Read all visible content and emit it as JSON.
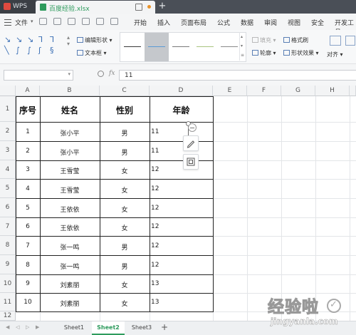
{
  "titlebar": {
    "app_label": "WPS",
    "doc_name": "百度经验.xlsx",
    "new_tab": "+"
  },
  "menubar": {
    "file_label": "文件",
    "items": [
      "开始",
      "插入",
      "页面布局",
      "公式",
      "数据",
      "审阅",
      "视图",
      "安全",
      "开发工具"
    ]
  },
  "ribbon": {
    "edit_shape": "编辑形状",
    "text_box": "文本框",
    "fill": "填充",
    "format_painter": "格式刷",
    "outline": "轮廓",
    "shape_effects": "形状效果",
    "align": "对齐",
    "style_colors": [
      "#3a3a3a",
      "#5b9bd5",
      "#7a7a7a",
      "#a9c47f",
      "#8a8a8a"
    ]
  },
  "formula_bar": {
    "name_box": "",
    "fx": "fx",
    "zoom_icon": "magnifier-icon",
    "value": "11"
  },
  "columns": [
    "A",
    "B",
    "C",
    "D",
    "E",
    "F",
    "G",
    "H"
  ],
  "rows": [
    "1",
    "2",
    "3",
    "4",
    "5",
    "6",
    "7",
    "8",
    "9",
    "10",
    "11",
    "12"
  ],
  "table": {
    "headers": [
      "序号",
      "姓名",
      "性别",
      "年龄"
    ],
    "rows": [
      [
        "1",
        "张小平",
        "男",
        "11"
      ],
      [
        "2",
        "张小平",
        "男",
        "11"
      ],
      [
        "3",
        "王雪莹",
        "女",
        "12"
      ],
      [
        "4",
        "王雪莹",
        "女",
        "12"
      ],
      [
        "5",
        "王依依",
        "女",
        "12"
      ],
      [
        "6",
        "王依依",
        "女",
        "12"
      ],
      [
        "7",
        "张一鸣",
        "男",
        "12"
      ],
      [
        "8",
        "张一鸣",
        "男",
        "12"
      ],
      [
        "9",
        "刘素丽",
        "女",
        "13"
      ],
      [
        "10",
        "刘素丽",
        "女",
        "13"
      ]
    ]
  },
  "sheets": {
    "tabs": [
      "Sheet1",
      "Sheet2",
      "Sheet3"
    ],
    "active": "Sheet2",
    "add": "+"
  },
  "watermark": {
    "main": "经验啦",
    "sub": "jingyanla.com"
  },
  "colors": {
    "accent": "#2e9b5d",
    "titlebar": "#4a4f57",
    "brand": "#e04a3f"
  }
}
